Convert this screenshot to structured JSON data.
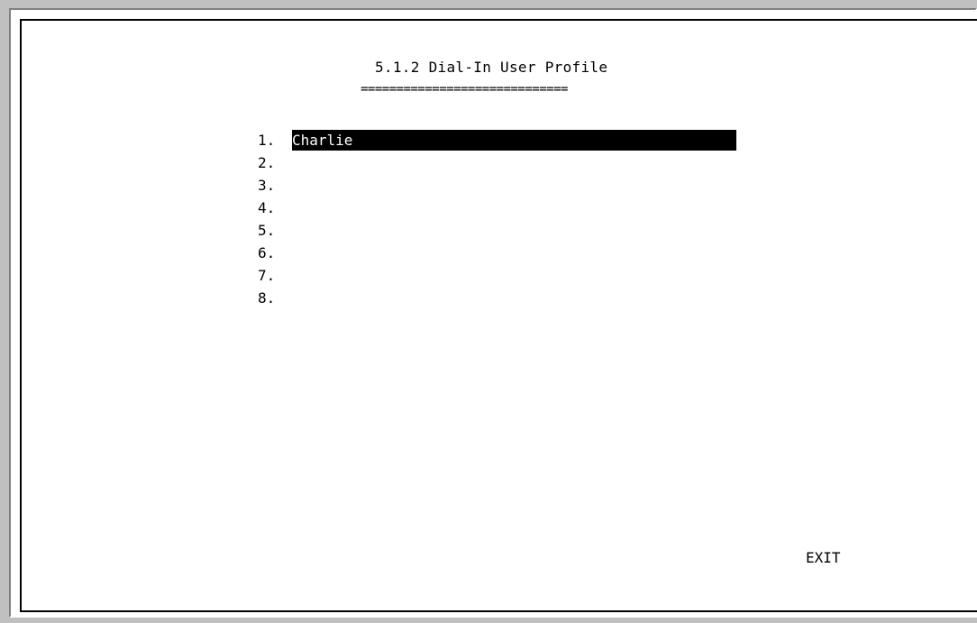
{
  "screen": {
    "title": "5.1.2 Dial-In User Profile",
    "underline": "============================="
  },
  "profiles": [
    {
      "number": "1.",
      "name": "Charlie",
      "selected": true
    },
    {
      "number": "2.",
      "name": "",
      "selected": false
    },
    {
      "number": "3.",
      "name": "",
      "selected": false
    },
    {
      "number": "4.",
      "name": "",
      "selected": false
    },
    {
      "number": "5.",
      "name": "",
      "selected": false
    },
    {
      "number": "6.",
      "name": "",
      "selected": false
    },
    {
      "number": "7.",
      "name": "",
      "selected": false
    },
    {
      "number": "8.",
      "name": "",
      "selected": false
    }
  ],
  "actions": {
    "exit_label": "EXIT"
  },
  "colors": {
    "highlight_bg": "#000000",
    "highlight_fg": "#ffffff",
    "background": "#ffffff",
    "frame": "#c0c0c0"
  }
}
